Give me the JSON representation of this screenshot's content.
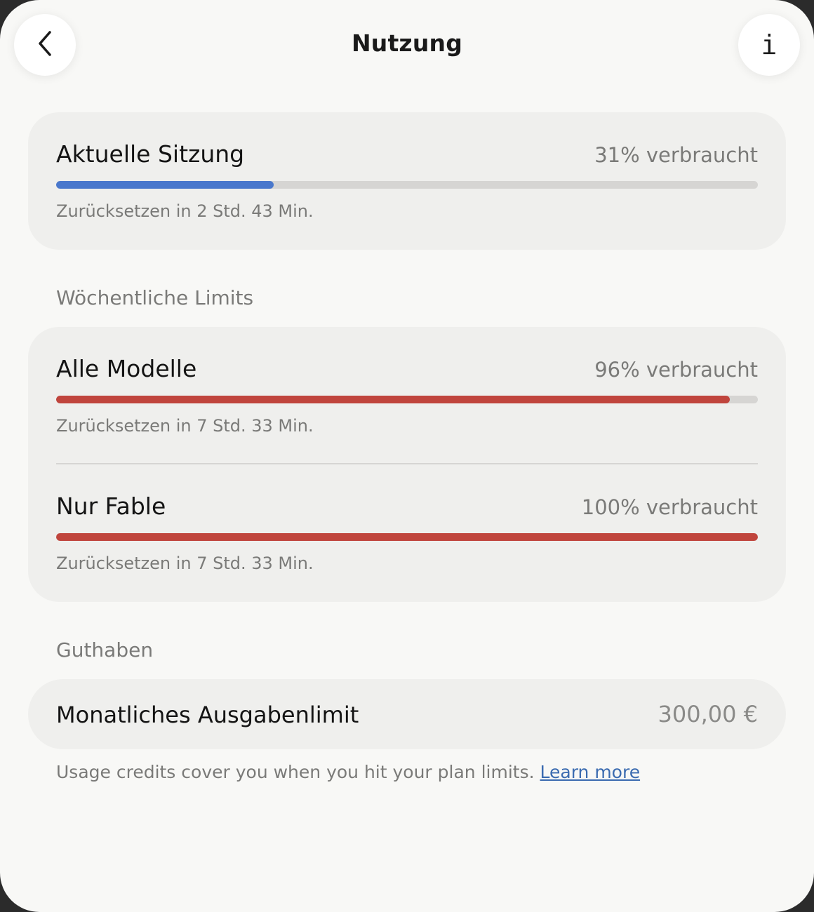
{
  "header": {
    "title": "Nutzung",
    "back_icon": "chevron-left-icon",
    "info_icon": "info-icon",
    "info_glyph": "i"
  },
  "session": {
    "title": "Aktuelle Sitzung",
    "used_label": "31% verbraucht",
    "progress": 0.31,
    "bar_color": "#4a78cc",
    "reset": "Zurücksetzen in 2 Std. 43 Min."
  },
  "weekly": {
    "section_label": "Wöchentliche Limits",
    "items": [
      {
        "title": "Alle Modelle",
        "used_label": "96% verbraucht",
        "progress": 0.96,
        "bar_color": "#c0453d",
        "reset": "Zurücksetzen in 7 Std. 33 Min."
      },
      {
        "title": "Nur Fable",
        "used_label": "100% verbraucht",
        "progress": 1.0,
        "bar_color": "#c0453d",
        "reset": "Zurücksetzen in 7 Std. 33 Min."
      }
    ]
  },
  "credits": {
    "section_label": "Guthaben",
    "limit_label": "Monatliches Ausgabenlimit",
    "limit_value": "300,00 €",
    "footnote": "Usage credits cover you when you hit your plan limits.",
    "learn_more": "Learn more"
  }
}
